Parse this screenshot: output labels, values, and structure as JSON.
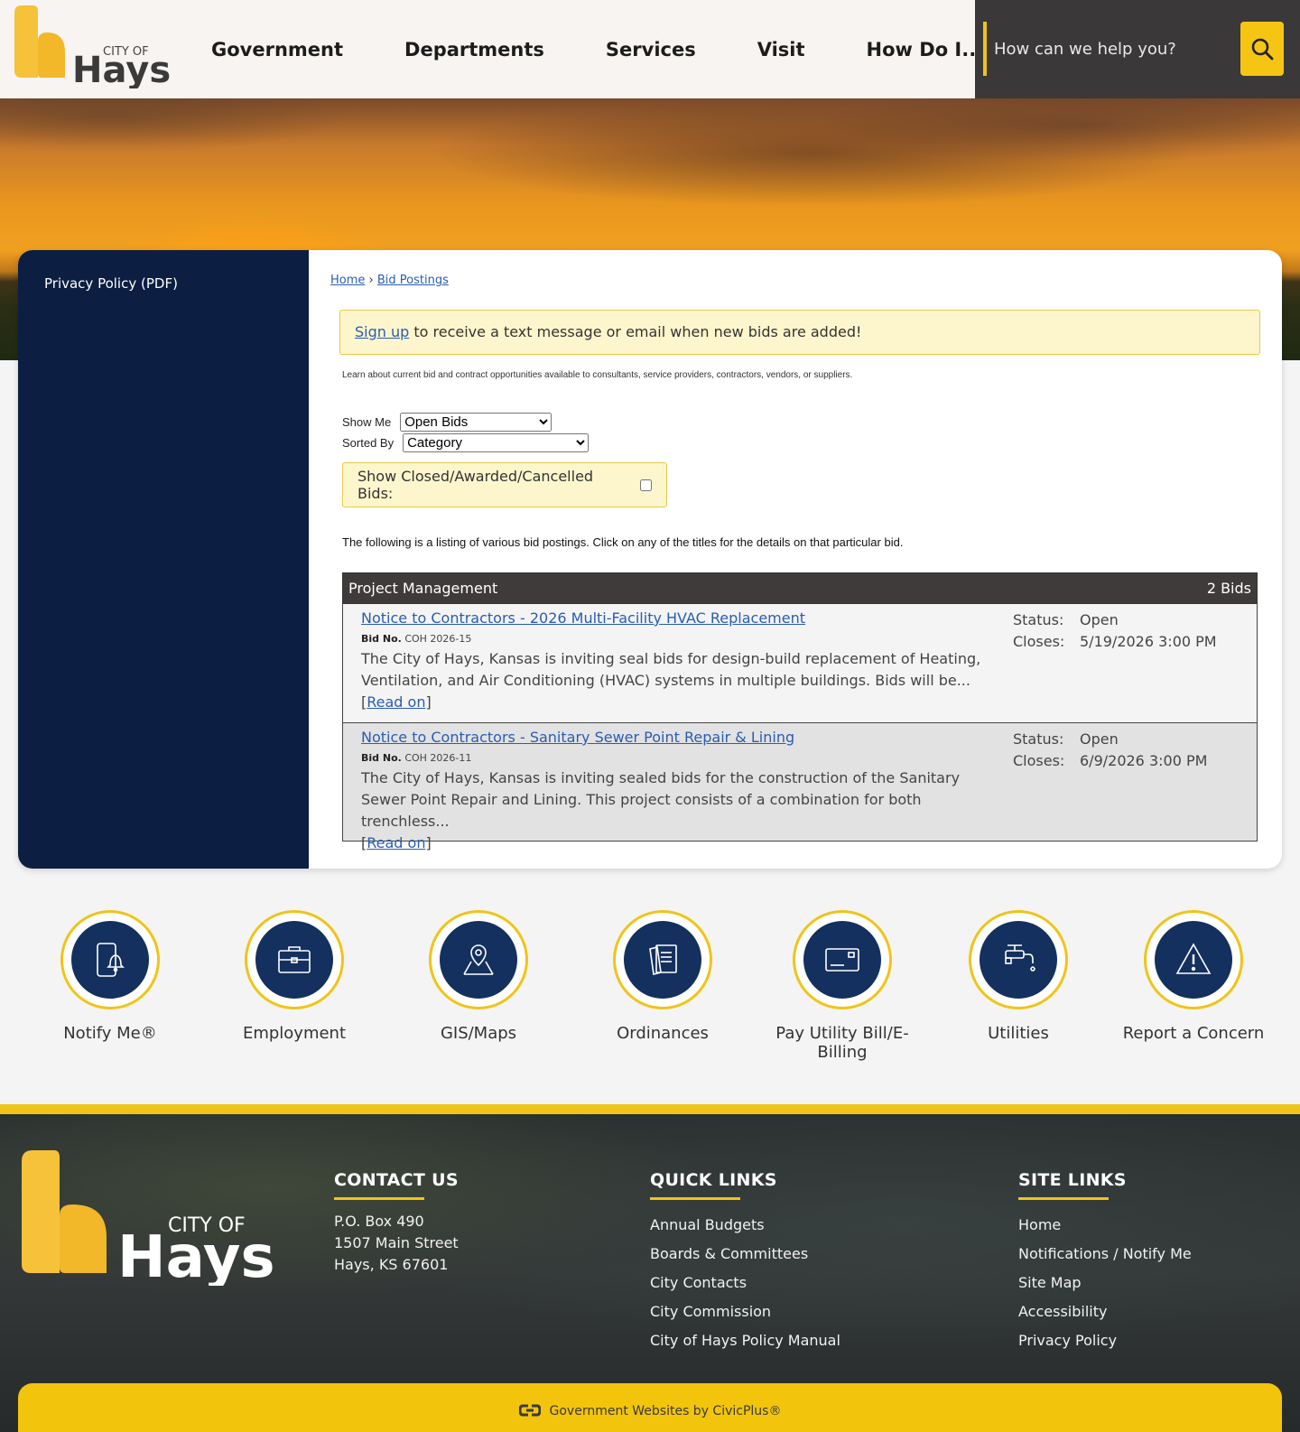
{
  "header": {
    "logo_city_of": "CITY OF",
    "logo_name": "Hays",
    "nav": [
      "Government",
      "Departments",
      "Services",
      "Visit",
      "How Do I..."
    ],
    "search_placeholder": "How can we help you?"
  },
  "sidebar": {
    "link": "Privacy Policy (PDF)"
  },
  "breadcrumb": {
    "home": "Home",
    "sep": "›",
    "current": "Bid Postings"
  },
  "alert": {
    "link": "Sign up",
    "text": " to receive a text message or email when new bids are added!"
  },
  "intro": "Learn about current bid and contract opportunities available to consultants, service providers, contractors, vendors, or suppliers.",
  "filters": {
    "show_me_label": "Show Me",
    "show_me_value": "Open Bids",
    "sorted_by_label": "Sorted By",
    "sorted_by_value": "Category",
    "closed_label": "Show Closed/Awarded/Cancelled Bids:"
  },
  "listing_note": "The following is a listing of various bid postings. Click on any of the titles for the details on that particular bid.",
  "bids": {
    "category": "Project Management",
    "count": "2 Bids",
    "items": [
      {
        "title": "Notice to Contractors - 2026 Multi-Facility HVAC Replacement",
        "bid_no_label": "Bid No.",
        "bid_no": "COH 2026-15",
        "desc": "The City of Hays, Kansas is inviting seal bids for design-build replacement of Heating, Ventilation, and Air Conditioning (HVAC) systems in multiple buildings. Bids will be...",
        "read_on": "Read on",
        "status_label": "Status:",
        "status": "Open",
        "closes_label": "Closes:",
        "closes": "5/19/2026 3:00 PM"
      },
      {
        "title": "Notice to Contractors - Sanitary Sewer Point Repair & Lining",
        "bid_no_label": "Bid No.",
        "bid_no": "COH 2026-11",
        "desc": "The City of Hays, Kansas is inviting sealed bids for the construction of the Sanitary Sewer Point Repair and Lining. This project consists of a combination for both trenchless...",
        "read_on": "Read on",
        "status_label": "Status:",
        "status": "Open",
        "closes_label": "Closes:",
        "closes": "6/9/2026 3:00 PM"
      }
    ]
  },
  "quick_links": [
    {
      "label": "Notify Me®",
      "icon": "bell-phone-icon"
    },
    {
      "label": "Employment",
      "icon": "briefcase-icon"
    },
    {
      "label": "GIS/Maps",
      "icon": "map-pin-icon"
    },
    {
      "label": "Ordinances",
      "icon": "documents-icon"
    },
    {
      "label": "Pay Utility Bill/E-Billing",
      "icon": "card-icon"
    },
    {
      "label": "Utilities",
      "icon": "faucet-icon"
    },
    {
      "label": "Report a Concern",
      "icon": "warning-icon"
    }
  ],
  "footer": {
    "contact": {
      "heading": "CONTACT US",
      "lines": [
        "P.O. Box 490",
        "1507 Main Street",
        "Hays, KS 67601"
      ]
    },
    "quick": {
      "heading": "QUICK LINKS",
      "links": [
        "Annual Budgets",
        "Boards & Committees",
        "City Contacts",
        "City Commission",
        "City of Hays Policy Manual"
      ]
    },
    "site": {
      "heading": "SITE LINKS",
      "links": [
        "Home",
        "Notifications / Notify Me",
        "Site Map",
        "Accessibility",
        "Privacy Policy"
      ]
    },
    "civicplus": "Government Websites by CivicPlus®"
  },
  "colors": {
    "navy": "#0c1e42",
    "gold": "#f0c419",
    "link": "#2a5db0"
  }
}
